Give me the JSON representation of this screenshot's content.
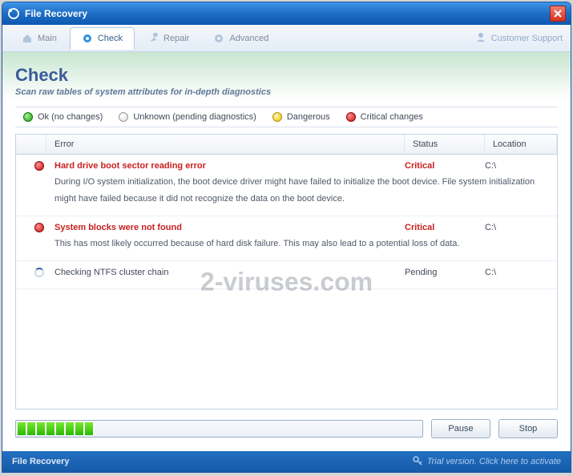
{
  "window": {
    "title": "File Recovery",
    "watermark": "2-viruses.com"
  },
  "toolbar": {
    "tabs": [
      {
        "label": "Main"
      },
      {
        "label": "Check"
      },
      {
        "label": "Repair"
      },
      {
        "label": "Advanced"
      }
    ],
    "support": "Customer Support"
  },
  "page": {
    "heading": "Check",
    "subheading": "Scan raw tables of system attributes for in-depth diagnostics"
  },
  "legend": {
    "ok": "Ok (no changes)",
    "unknown": "Unknown (pending diagnostics)",
    "dangerous": "Dangerous",
    "critical": "Critical changes"
  },
  "columns": {
    "error": "Error",
    "status": "Status",
    "location": "Location"
  },
  "rows": [
    {
      "severity": "critical",
      "title": "Hard drive boot sector reading error",
      "status": "Critical",
      "location": "C:\\",
      "desc": "During I/O system initialization, the boot device driver might have failed to initialize the boot device. File system initialization might have failed because it did not recognize the data on the boot device."
    },
    {
      "severity": "critical",
      "title": "System blocks were not found",
      "status": "Critical",
      "location": "C:\\",
      "desc": "This has most likely occurred because of hard disk failure. This may also lead to a potential loss of data."
    },
    {
      "severity": "pending",
      "title": "Checking NTFS cluster chain",
      "status": "Pending",
      "location": "C:\\",
      "desc": ""
    }
  ],
  "progress": {
    "blocks": 8
  },
  "buttons": {
    "pause": "Pause",
    "stop": "Stop"
  },
  "statusbar": {
    "left": "File Recovery",
    "right": "Trial version. Click here to activate"
  }
}
